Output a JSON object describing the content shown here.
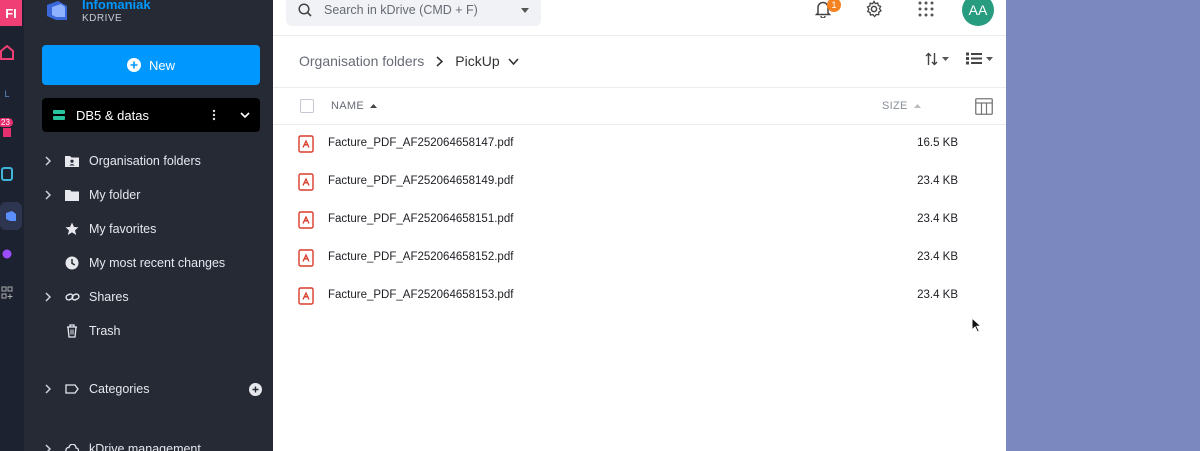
{
  "rail": {
    "app_badge": "FI",
    "calendar_badge": "23",
    "mail_label": "L"
  },
  "brand": {
    "name": "Infomaniak",
    "product": "KDRIVE"
  },
  "sidebar": {
    "new_label": "New",
    "drive_name": "DB5 & datas",
    "nav": [
      {
        "label": "Organisation folders",
        "icon": "shared-folder-icon",
        "expandable": true
      },
      {
        "label": "My folder",
        "icon": "folder-icon",
        "expandable": true
      },
      {
        "label": "My favorites",
        "icon": "star-icon",
        "expandable": false
      },
      {
        "label": "My most recent changes",
        "icon": "clock-icon",
        "expandable": false
      },
      {
        "label": "Shares",
        "icon": "link-icon",
        "expandable": true
      },
      {
        "label": "Trash",
        "icon": "trash-icon",
        "expandable": false
      }
    ],
    "categories_label": "Categories",
    "management_label": "kDrive management"
  },
  "header": {
    "search_placeholder": "Search in kDrive (CMD + F)",
    "notifications_count": "1",
    "avatar_initials": "AA"
  },
  "breadcrumb": {
    "parent": "Organisation folders",
    "current": "PickUp"
  },
  "table": {
    "col_name": "NAME",
    "col_size": "SIZE",
    "rows": [
      {
        "name": "Facture_PDF_AF252064658147.pdf",
        "size": "16.5 KB"
      },
      {
        "name": "Facture_PDF_AF252064658149.pdf",
        "size": "23.4 KB"
      },
      {
        "name": "Facture_PDF_AF252064658151.pdf",
        "size": "23.4 KB"
      },
      {
        "name": "Facture_PDF_AF252064658152.pdf",
        "size": "23.4 KB"
      },
      {
        "name": "Facture_PDF_AF252064658153.pdf",
        "size": "23.4 KB"
      }
    ]
  },
  "colors": {
    "accent": "#0098ff",
    "sidebar_bg": "#262a35",
    "pdf_red": "#d93b2b",
    "avatar": "#279c7e",
    "badge": "#f58220"
  }
}
